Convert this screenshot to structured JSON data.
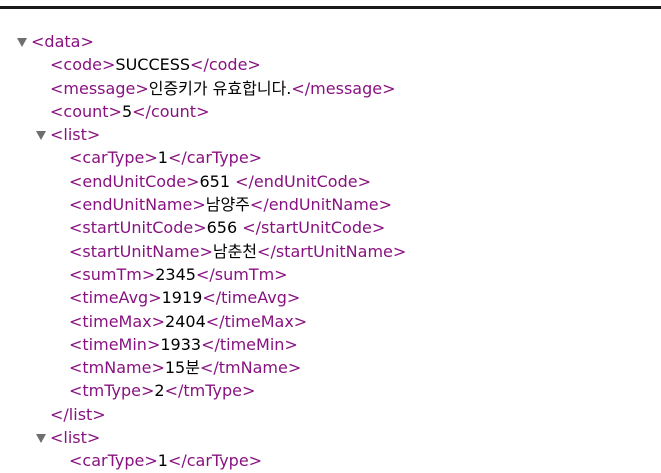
{
  "root": {
    "open": "<data>"
  },
  "code": {
    "open": "<code>",
    "value": "SUCCESS",
    "close": "</code>"
  },
  "message": {
    "open": "<message>",
    "value": "인증키가 유효합니다.",
    "close": "</message>"
  },
  "count": {
    "open": "<count>",
    "value": "5",
    "close": "</count>"
  },
  "list_open": "<list>",
  "list_close": "</list>",
  "list_items": [
    {
      "open": "<carType>",
      "value": "1",
      "close": "</carType>"
    },
    {
      "open": "<endUnitCode>",
      "value": "651 ",
      "close": "</endUnitCode>"
    },
    {
      "open": "<endUnitName>",
      "value": "남양주",
      "close": "</endUnitName>"
    },
    {
      "open": "<startUnitCode>",
      "value": "656 ",
      "close": "</startUnitCode>"
    },
    {
      "open": "<startUnitName>",
      "value": "남춘천",
      "close": "</startUnitName>"
    },
    {
      "open": "<sumTm>",
      "value": "2345",
      "close": "</sumTm>"
    },
    {
      "open": "<timeAvg>",
      "value": "1919",
      "close": "</timeAvg>"
    },
    {
      "open": "<timeMax>",
      "value": "2404",
      "close": "</timeMax>"
    },
    {
      "open": "<timeMin>",
      "value": "1933",
      "close": "</timeMin>"
    },
    {
      "open": "<tmName>",
      "value": "15분",
      "close": "</tmName>"
    },
    {
      "open": "<tmType>",
      "value": "2",
      "close": "</tmType>"
    }
  ],
  "list2_open": "<list>",
  "list2_partial": {
    "open": "<carType>",
    "value": "1",
    "close": "</carType>"
  },
  "colors": {
    "tag": "#881280",
    "text": "#000000",
    "toggle": "#6e6e6e"
  },
  "icons": {
    "toggle": "triangle-down-icon"
  }
}
